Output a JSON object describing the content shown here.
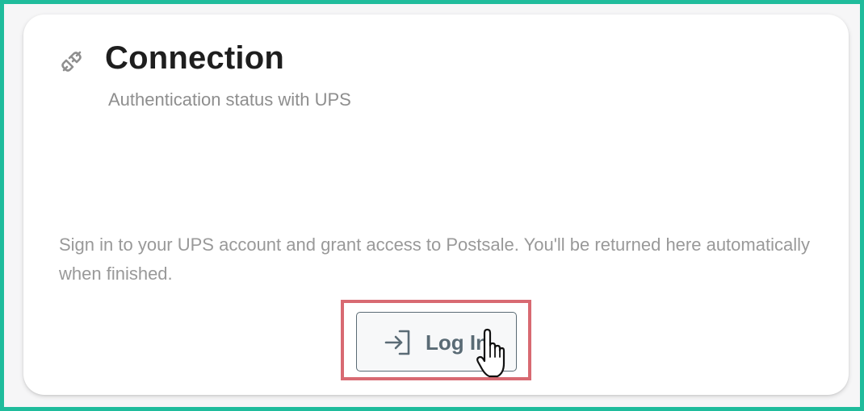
{
  "card": {
    "title": "Connection",
    "subtitle": "Authentication status with UPS",
    "description": "Sign in to your UPS account and grant access to Postsale. You'll be returned here automatically when finished.",
    "icon": "plug-disconnected-icon"
  },
  "login_button": {
    "label": "Log In",
    "icon": "sign-in-icon"
  },
  "colors": {
    "frame_border": "#1fbc9c",
    "highlight_border": "#d86a72",
    "button_text": "#5a6b75",
    "title": "#1e1e1e",
    "muted_text": "#999999"
  }
}
